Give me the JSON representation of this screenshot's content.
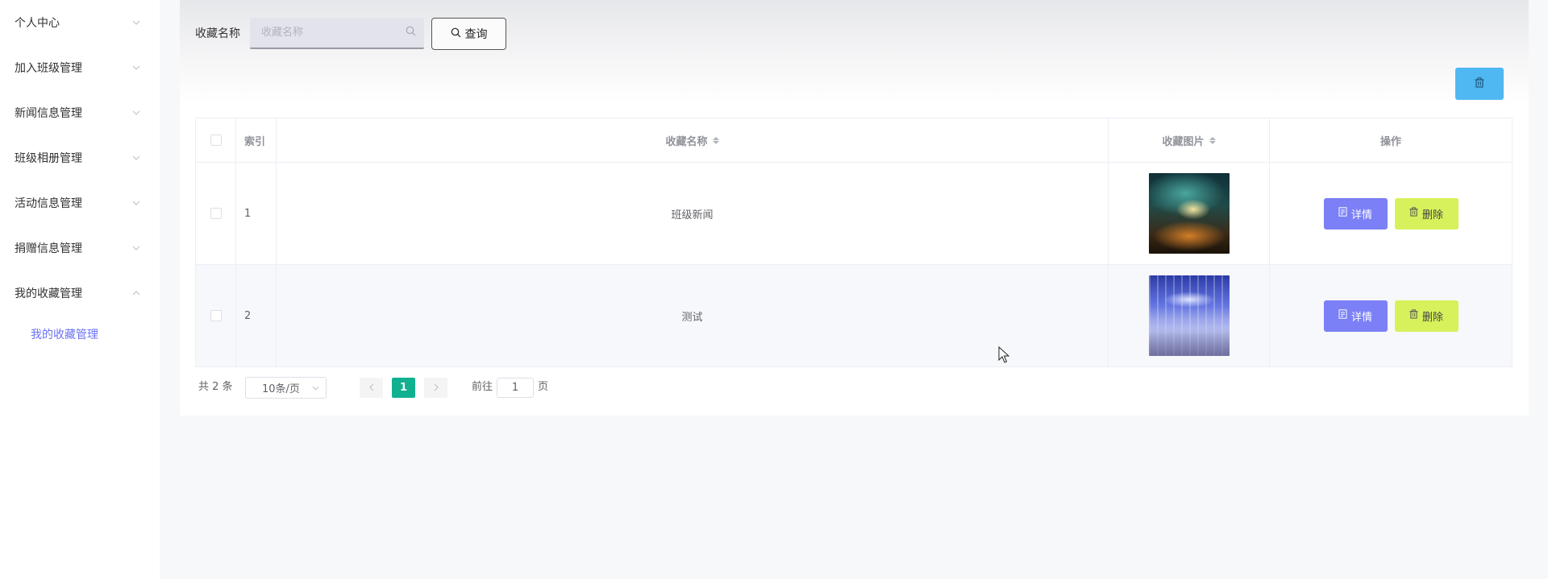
{
  "sidebar": {
    "items": [
      {
        "label": "个人中心",
        "expanded": false
      },
      {
        "label": "加入班级管理",
        "expanded": false
      },
      {
        "label": "新闻信息管理",
        "expanded": false
      },
      {
        "label": "班级相册管理",
        "expanded": false
      },
      {
        "label": "活动信息管理",
        "expanded": false
      },
      {
        "label": "捐赠信息管理",
        "expanded": false
      },
      {
        "label": "我的收藏管理",
        "expanded": true
      }
    ],
    "active_sub_item": "我的收藏管理"
  },
  "search": {
    "label": "收藏名称",
    "placeholder": "收藏名称",
    "value": "",
    "button_label": "查询"
  },
  "toolbar": {
    "batch_delete_icon": "trash-icon",
    "batch_delete_color": "#4fb8f2"
  },
  "table": {
    "headers": {
      "index": "索引",
      "name": "收藏名称",
      "image": "收藏图片",
      "actions": "操作"
    },
    "rows": [
      {
        "index": "1",
        "name": "班级新闻",
        "image": "night-scene-thumbnail"
      },
      {
        "index": "2",
        "name": "测试",
        "image": "hall-interior-thumbnail"
      }
    ],
    "detail_label": "详情",
    "delete_label": "删除"
  },
  "pagination": {
    "total_text": "共 2 条",
    "page_size": "10条/页",
    "current_page": "1",
    "goto_label": "前往",
    "goto_value": "1",
    "page_unit": "页",
    "accent_color": "#10b090"
  },
  "colors": {
    "detail_button": "#7b80f6",
    "delete_button": "#d6f15c",
    "active_menu_text": "#6a72f5"
  }
}
